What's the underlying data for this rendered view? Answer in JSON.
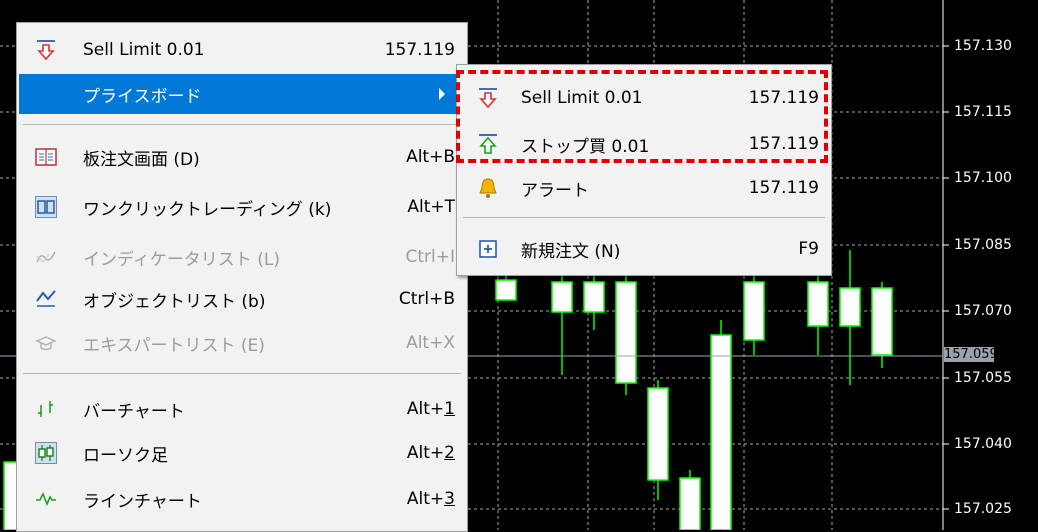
{
  "chart": {
    "price_labels": [
      "157.130",
      "157.115",
      "157.100",
      "157.085",
      "157.070",
      "157.055",
      "157.040",
      "157.025"
    ],
    "current_price": "157.059"
  },
  "main_menu": {
    "items": [
      {
        "label": "Sell Limit 0.01",
        "shortcut": "157.119",
        "icon": "sell-arrow-icon"
      },
      {
        "label": "プライスボード",
        "icon": "none",
        "highlighted": true,
        "has_submenu": true
      },
      {
        "label": "板注文画面 (D)",
        "shortcut": "Alt+B",
        "icon": "order-book-icon"
      },
      {
        "label": "ワンクリックトレーディング (k)",
        "shortcut": "Alt+T",
        "icon": "one-click-icon"
      },
      {
        "label": "インディケータリスト (L)",
        "shortcut": "Ctrl+I",
        "icon": "indicator-icon",
        "disabled": true
      },
      {
        "label": "オブジェクトリスト (b)",
        "shortcut": "Ctrl+B",
        "icon": "object-list-icon"
      },
      {
        "label": "エキスパートリスト (E)",
        "shortcut": "Alt+X",
        "icon": "expert-icon",
        "disabled": true
      },
      {
        "label": "バーチャート",
        "shortcut": "Alt+1",
        "icon": "bar-chart-icon"
      },
      {
        "label": "ローソク足",
        "shortcut": "Alt+2",
        "icon": "candlestick-icon"
      },
      {
        "label": "ラインチャート",
        "shortcut": "Alt+3",
        "icon": "line-chart-icon"
      }
    ]
  },
  "sub_menu": {
    "items": [
      {
        "label": "Sell Limit 0.01",
        "value": "157.119",
        "icon": "sell-arrow-icon"
      },
      {
        "label": "ストップ買 0.01",
        "value": "157.119",
        "icon": "buy-arrow-icon"
      },
      {
        "label": "アラート",
        "value": "157.119",
        "icon": "bell-icon"
      },
      {
        "label": "新規注文 (N)",
        "value": "F9",
        "icon": "new-order-icon"
      }
    ]
  },
  "colors": {
    "highlight": "#0078d7",
    "candle": "#00ff00",
    "annotation": "#e00000"
  }
}
